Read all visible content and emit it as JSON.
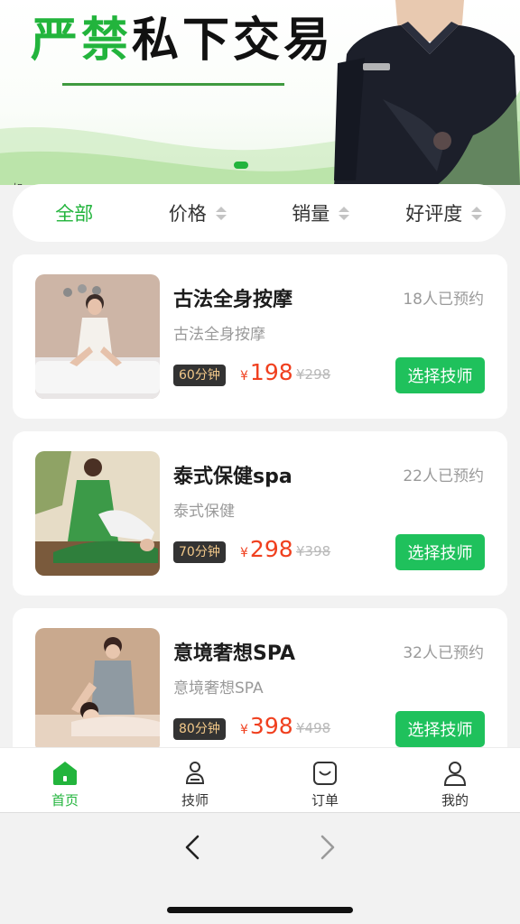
{
  "banner": {
    "title_green": "严禁",
    "title_black": "私下交易",
    "corner_text": "如"
  },
  "sort": {
    "items": [
      {
        "label": "全部",
        "active": true
      },
      {
        "label": "价格",
        "active": false
      },
      {
        "label": "销量",
        "active": false
      },
      {
        "label": "好评度",
        "active": false
      }
    ]
  },
  "services": [
    {
      "title": "古法全身按摩",
      "booked": "18人已预约",
      "subtitle": "古法全身按摩",
      "duration": "60分钟",
      "currency": "¥",
      "price": "198",
      "old_price": "¥298",
      "button": "选择技师"
    },
    {
      "title": "泰式保健spa",
      "booked": "22人已预约",
      "subtitle": "泰式保健",
      "duration": "70分钟",
      "currency": "¥",
      "price": "298",
      "old_price": "¥398",
      "button": "选择技师"
    },
    {
      "title": "意境奢想SPA",
      "booked": "32人已预约",
      "subtitle": "意境奢想SPA",
      "duration": "80分钟",
      "currency": "¥",
      "price": "398",
      "old_price": "¥498",
      "button": "选择技师"
    }
  ],
  "tabbar": {
    "items": [
      {
        "label": "首页",
        "icon": "home-icon",
        "active": true
      },
      {
        "label": "技师",
        "icon": "technician-icon",
        "active": false
      },
      {
        "label": "订单",
        "icon": "order-icon",
        "active": false
      },
      {
        "label": "我的",
        "icon": "profile-icon",
        "active": false
      }
    ]
  },
  "colors": {
    "accent": "#22b43c",
    "button": "#1fc15c",
    "price": "#f0401f",
    "muted": "#9a9a9a"
  }
}
